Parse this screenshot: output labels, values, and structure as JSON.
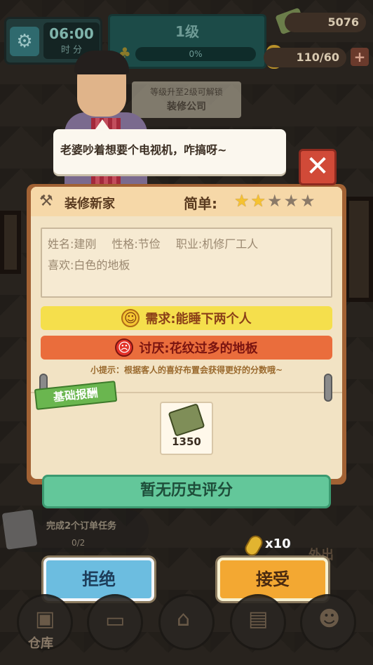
{
  "hud": {
    "clock_time": "06:00",
    "clock_units": "时 分",
    "level_label": "1级",
    "level_progress_text": "0%",
    "money": "5076",
    "corn": "110/60",
    "plus": "+",
    "unlock_note_line1": "等级升至2级可解锁",
    "unlock_note_line2": "装修公司"
  },
  "customer": {
    "speech": "老婆吵着想要个电视机，咋搞呀~"
  },
  "task": {
    "title": "装修新家",
    "difficulty_label": "简单:",
    "stars_on": 2,
    "stars_total": 5,
    "info": {
      "name": "姓名:建刚",
      "personality": "性格:节俭",
      "job": "职业:机修厂工人",
      "likes": "喜欢:白色的地板"
    },
    "need": "需求:能睡下两个人",
    "hate": "讨厌:花纹过多的地板",
    "tip": "小提示：根据客人的喜好布置会获得更好的分数哦~"
  },
  "reward": {
    "tag": "基础报酬",
    "amount": "1350"
  },
  "history": "暂无历史评分",
  "quest": {
    "text": "完成2个订单任务",
    "progress": "0/2"
  },
  "bonus_corn": "x10",
  "door_label": "外出",
  "buttons": {
    "reject": "拒绝",
    "accept": "接受",
    "close": "✕"
  },
  "nav": {
    "warehouse": "仓库"
  },
  "colors": {
    "accept": "#f3a832",
    "reject": "#6cbde0",
    "need": "#f5df4c",
    "hate": "#ea6d3c",
    "history": "#63c79a"
  }
}
